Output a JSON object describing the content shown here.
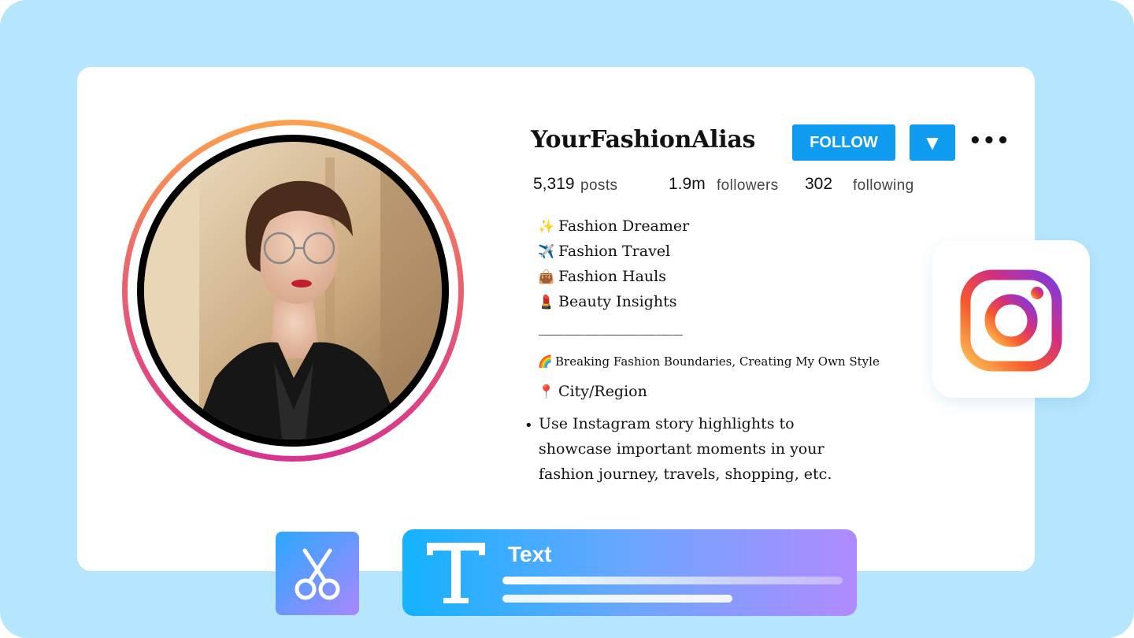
{
  "profile": {
    "username": "YourFashionAlias",
    "follow_label": "FOLLOW",
    "dropdown_glyph": "▼",
    "more_glyph": "•••",
    "stats": {
      "posts_count": "5,319",
      "posts_label": "posts",
      "followers_count": "1.9m",
      "followers_label": "followers",
      "following_count": "302",
      "following_label": "following"
    }
  },
  "bio": {
    "lines": [
      {
        "emoji": "✨",
        "text": "Fashion Dreamer"
      },
      {
        "emoji": "✈️",
        "text": "Fashion Travel"
      },
      {
        "emoji": "👜",
        "text": "Fashion Hauls"
      },
      {
        "emoji": "💄",
        "text": "Beauty Insights"
      }
    ],
    "divider": "________________",
    "tagline_emoji": "🌈",
    "tagline": "Breaking Fashion Boundaries, Creating My Own Style",
    "location_emoji": "📍",
    "location": "City/Region"
  },
  "tip": {
    "bullet": "•",
    "text": "Use Instagram story highlights to showcase important moments in your fashion journey, travels, shopping, etc."
  },
  "tools": {
    "text_tool_label": "Text",
    "text_tool_icon": "text-icon",
    "cut_tool_icon": "scissors-icon"
  },
  "colors": {
    "background": "#b6e6fd",
    "button": "#0f9bf0",
    "ring_top": "#fca14d",
    "ring_bottom": "#d6338f"
  }
}
